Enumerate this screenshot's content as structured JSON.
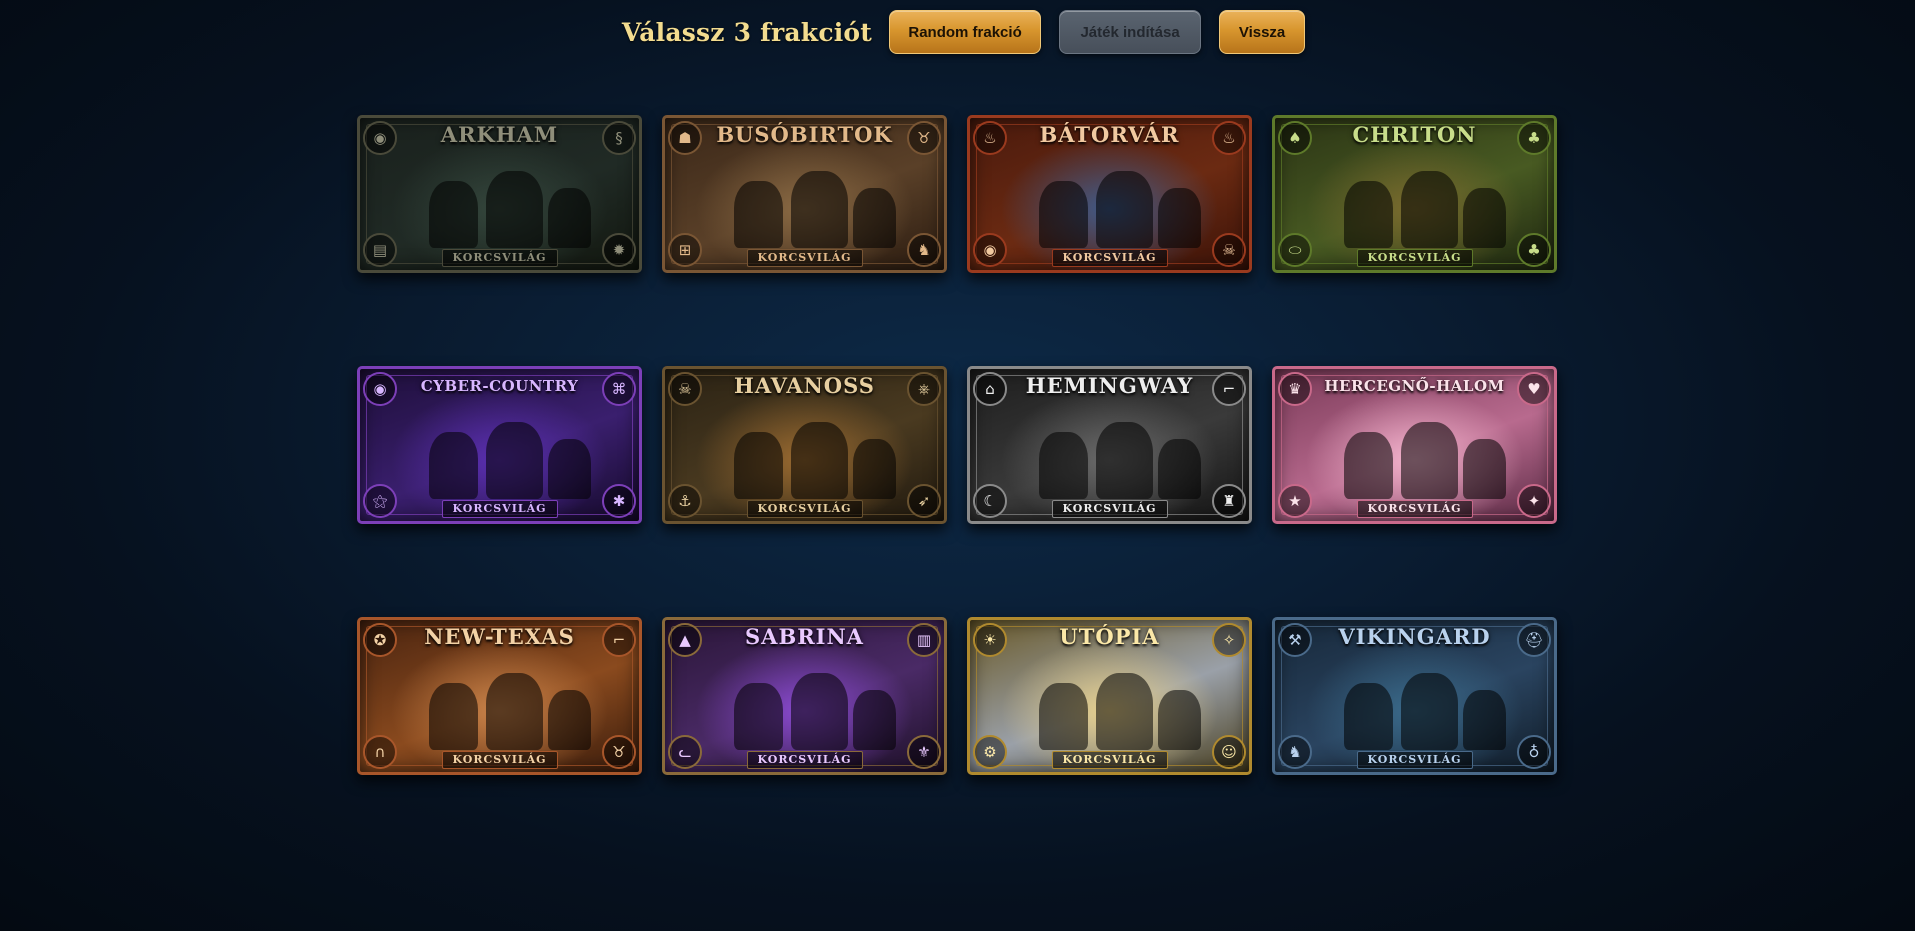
{
  "header": {
    "title": "Válassz 3 frakciót",
    "random_label": "Random frakció",
    "start_label": "Játék indítása",
    "back_label": "Vissza"
  },
  "factions": [
    {
      "name": "ARKHAM",
      "subtitle": "KORCSVILÁG",
      "icons": [
        "eye-icon",
        "tentacle-icon",
        "book-icon",
        "lantern-icon"
      ],
      "colors": {
        "frame": "#4a4a3a",
        "name": "#8f8e7a",
        "c1": "#1a211d",
        "c2": "#202a25",
        "c3": "#12170f",
        "glow": "#34463c"
      }
    },
    {
      "name": "BUSÓBIRTOK",
      "subtitle": "KORCSVILÁG",
      "icons": [
        "mask-icon",
        "horned-skull-icon",
        "wagon-icon",
        "wolf-icon"
      ],
      "colors": {
        "frame": "#7a5634",
        "name": "#e2b98a",
        "c1": "#3a2718",
        "c2": "#5a4028",
        "c3": "#2a1b10",
        "glow": "#8a6a44"
      }
    },
    {
      "name": "BÁTORVÁR",
      "subtitle": "KORCSVILÁG",
      "icons": [
        "flame-icon",
        "flame-icon",
        "eye-icon",
        "skull-icon"
      ],
      "colors": {
        "frame": "#9a3a1e",
        "name": "#f1c9a0",
        "c1": "#4a1a0d",
        "c2": "#6b2a12",
        "c3": "#3a1208",
        "glow": "#3e5a8a"
      }
    },
    {
      "name": "CHRITON",
      "subtitle": "KORCSVILÁG",
      "icons": [
        "dinosaur-icon",
        "leaf-icon",
        "egg-icon",
        "leaf-icon"
      ],
      "colors": {
        "frame": "#5e7a2a",
        "name": "#c8dd8a",
        "c1": "#2b3415",
        "c2": "#485a22",
        "c3": "#1e2610",
        "glow": "#7a6a2e"
      }
    },
    {
      "name": "CYBER-COUNTRY",
      "subtitle": "KORCSVILÁG",
      "icons": [
        "eye-icon",
        "glyph-icon",
        "sigil-icon",
        "snowflake-icon"
      ],
      "colors": {
        "frame": "#7c3fb8",
        "name": "#d8b6ff",
        "c1": "#1e0f3a",
        "c2": "#3a1f6e",
        "c3": "#160a2c",
        "glow": "#5a2fb0"
      }
    },
    {
      "name": "HAVANOSS",
      "subtitle": "KORCSVILÁG",
      "icons": [
        "skull-icon",
        "wheel-icon",
        "anchor-icon",
        "bird-icon"
      ],
      "colors": {
        "frame": "#6a5330",
        "name": "#e7cfa0",
        "c1": "#2a2214",
        "c2": "#4a3a20",
        "c3": "#1f180e",
        "glow": "#9a6a30"
      }
    },
    {
      "name": "HEMINGWAY",
      "subtitle": "KORCSVILÁG",
      "icons": [
        "hat-icon",
        "gun-icon",
        "crescent-icon",
        "bottle-icon"
      ],
      "colors": {
        "frame": "#8a8a8a",
        "name": "#eeeeee",
        "c1": "#1e1e1e",
        "c2": "#3a3a3a",
        "c3": "#141414",
        "glow": "#6a6a6a"
      }
    },
    {
      "name": "HERCEGNŐ-HALOM",
      "subtitle": "KORCSVILÁG",
      "icons": [
        "crown-icon",
        "heart-icon",
        "star-icon",
        "wand-icon"
      ],
      "colors": {
        "frame": "#c9698a",
        "name": "#fbe3ea",
        "c1": "#7a3a58",
        "c2": "#b86a8e",
        "c3": "#5a2a44",
        "glow": "#f2b3cc"
      }
    },
    {
      "name": "NEW-TEXAS",
      "subtitle": "KORCSVILÁG",
      "icons": [
        "sheriff-star-icon",
        "revolver-icon",
        "horseshoe-icon",
        "bull-skull-icon"
      ],
      "colors": {
        "frame": "#a8562a",
        "name": "#f3d2a6",
        "c1": "#4a2410",
        "c2": "#8a4a1e",
        "c3": "#3a1c0c",
        "glow": "#c9834a"
      }
    },
    {
      "name": "SABRINA",
      "subtitle": "KORCSVILÁG",
      "icons": [
        "witch-hat-icon",
        "spellbook-icon",
        "cat-icon",
        "fleur-de-lis-icon"
      ],
      "colors": {
        "frame": "#8a6a3a",
        "name": "#e9c9ff",
        "c1": "#2a1638",
        "c2": "#4a2a66",
        "c3": "#1e1028",
        "glow": "#8a4ad0"
      }
    },
    {
      "name": "UTÓPIA",
      "subtitle": "KORCSVILÁG",
      "icons": [
        "lightbulb-icon",
        "angel-icon",
        "gear-icon",
        "robot-icon"
      ],
      "colors": {
        "frame": "#b08a2e",
        "name": "#fbe8a8",
        "c1": "#6a5a2a",
        "c2": "#9aa0a8",
        "c3": "#4a4020",
        "glow": "#e8d08a"
      }
    },
    {
      "name": "VIKINGARD",
      "subtitle": "KORCSVILÁG",
      "icons": [
        "axe-icon",
        "helmet-icon",
        "wolf-icon",
        "mammoth-icon"
      ],
      "colors": {
        "frame": "#4a6a8a",
        "name": "#b9d2ee",
        "c1": "#17283a",
        "c2": "#2a4460",
        "c3": "#101c28",
        "glow": "#3a6a8a"
      }
    }
  ]
}
